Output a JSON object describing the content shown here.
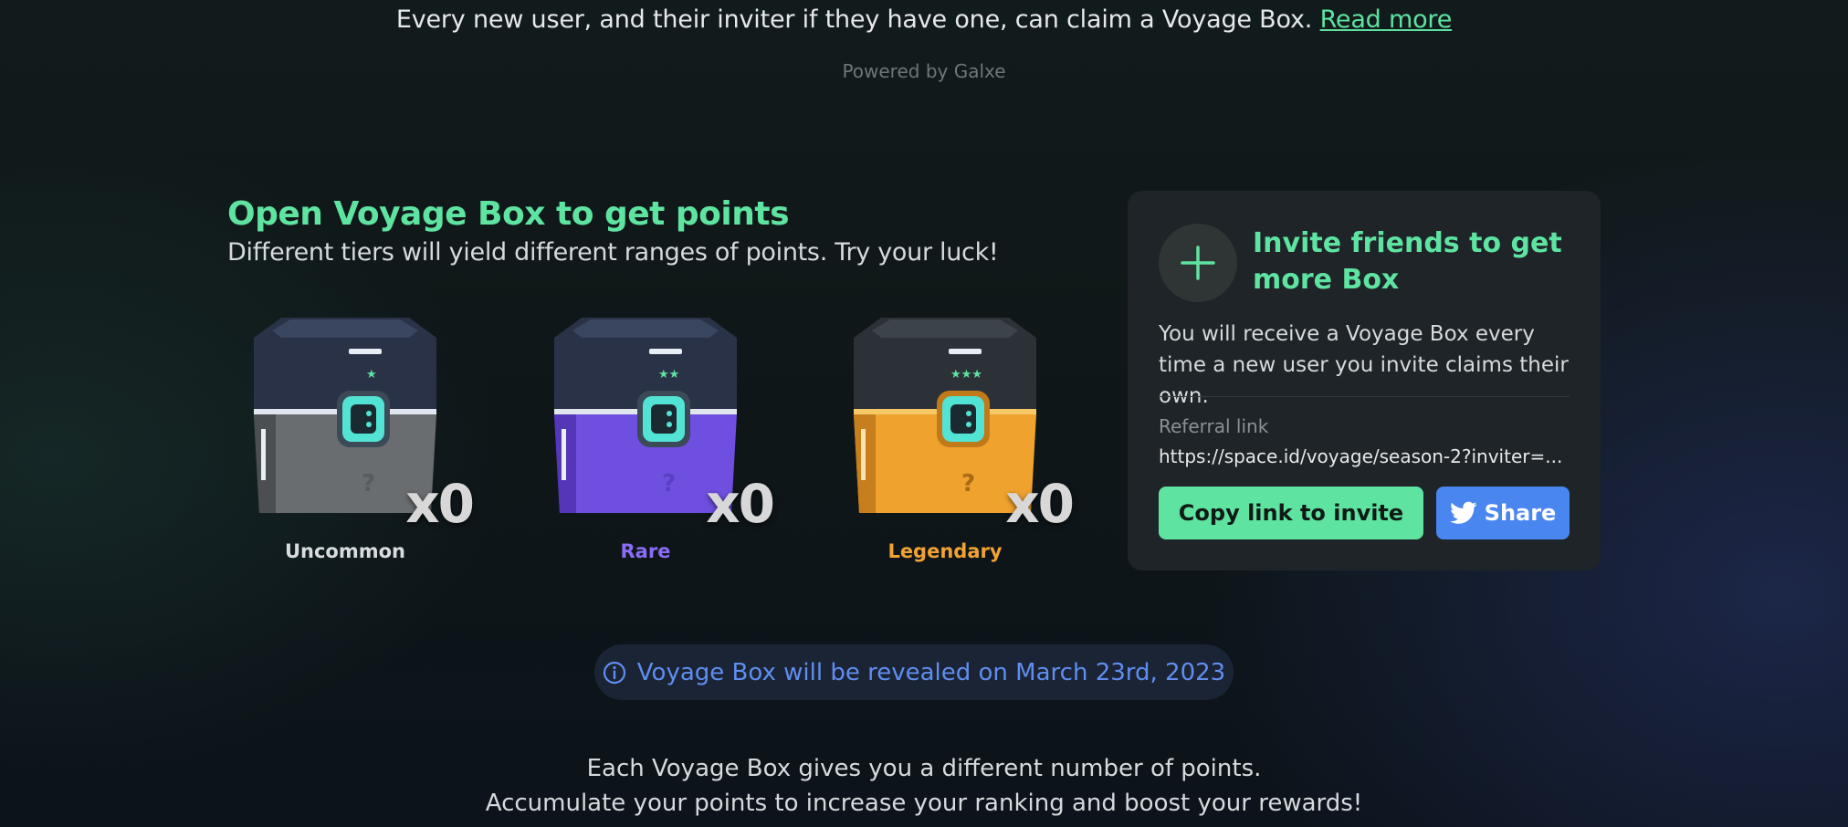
{
  "header": {
    "intro_text": "Every new user, and their inviter if they have one, can claim a Voyage Box.",
    "read_more_label": "Read more",
    "powered_by": "Powered by Galxe"
  },
  "boxes_section": {
    "title": "Open Voyage Box to get points",
    "subtitle": "Different tiers will yield different ranges of points. Try your luck!",
    "boxes": [
      {
        "tier": "Uncommon",
        "count": "x0",
        "stars": 1,
        "color": "#d9dcdf",
        "body_color": "#6a6d70"
      },
      {
        "tier": "Rare",
        "count": "x0",
        "stars": 2,
        "color": "#8a6cf5",
        "body_color": "#6f4fe0"
      },
      {
        "tier": "Legendary",
        "count": "x0",
        "stars": 3,
        "color": "#f0a232",
        "body_color": "#f0a22e"
      }
    ]
  },
  "invite_card": {
    "title": "Invite friends to get more Box",
    "description": "You will receive a Voyage Box every time a new user you invite claims their own.",
    "referral_label": "Referral link",
    "referral_link": "https://space.id/voyage/season-2?inviter=...",
    "copy_button": "Copy link to invite",
    "share_button": "Share",
    "icons": {
      "plus": "plus-icon",
      "share": "twitter-icon"
    }
  },
  "notice": {
    "text": "Voyage Box will be revealed on March 23rd, 2023",
    "icon": "info-icon"
  },
  "footer": {
    "line1": "Each Voyage Box gives you a different number of points.",
    "line2": "Accumulate your points to increase your ranking and boost your rewards!"
  },
  "colors": {
    "accent_green": "#5ee3a1",
    "accent_blue": "#4a86f0",
    "card_bg": "#1e2427"
  }
}
